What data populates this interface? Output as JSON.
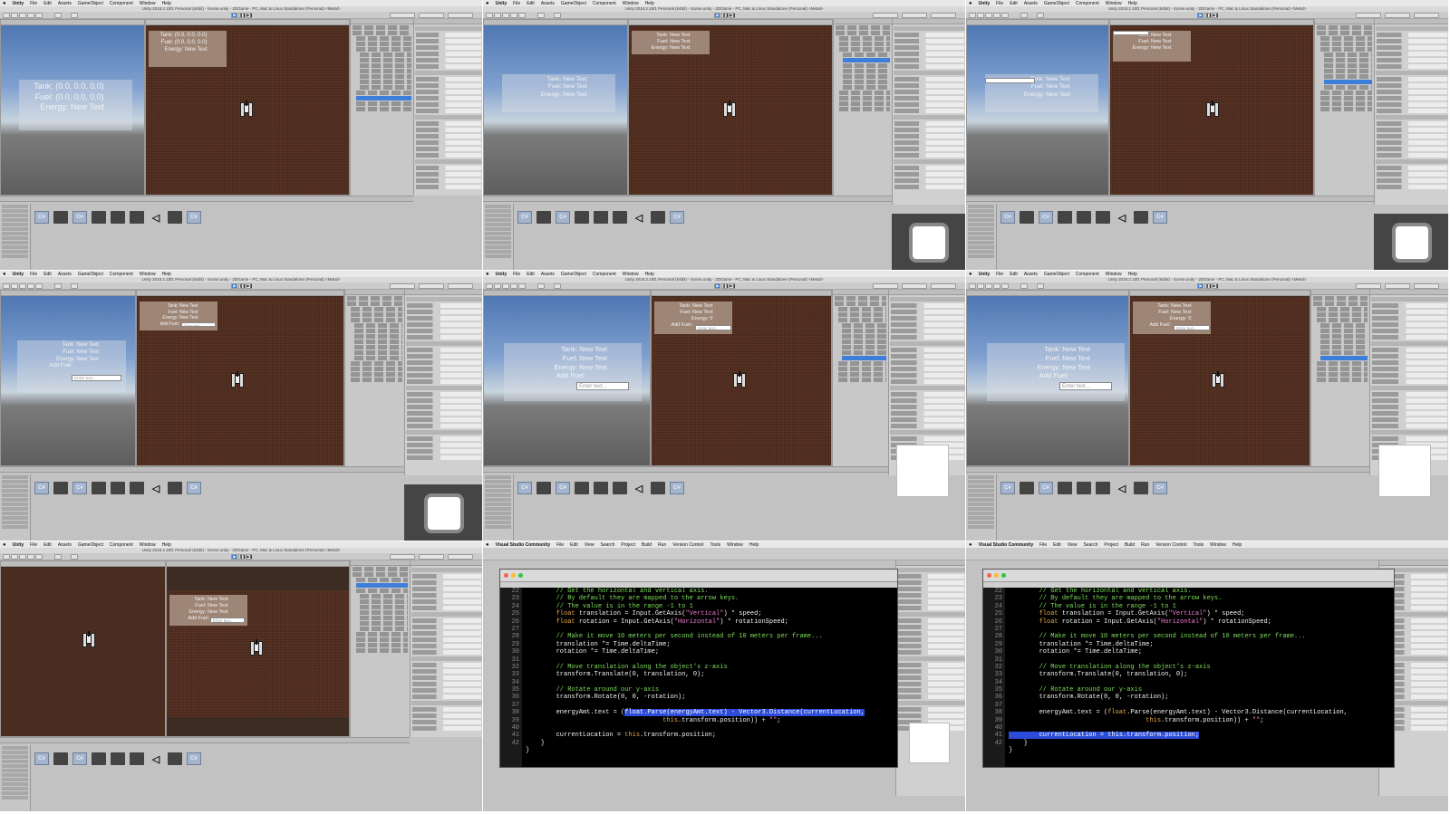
{
  "menubar": {
    "unity": [
      "Unity",
      "File",
      "Edit",
      "Assets",
      "GameObject",
      "Component",
      "Window",
      "Help"
    ],
    "vs": [
      "Visual Studio Community",
      "File",
      "Edit",
      "View",
      "Search",
      "Project",
      "Build",
      "Run",
      "Version Control",
      "Tools",
      "Window",
      "Help"
    ]
  },
  "window_title": "Unity 2018.2.15f1 Personal (64bit) - Scene.unity - 2DGame - PC, Mac & Linux Standalone (Personal) <Metal>",
  "game_ui": {
    "tank_vec": "Tank: (0.0, 0.0, 0.0)",
    "fuel_vec": "Fuel: (0.0, 0.0, 0.0)",
    "tank_text": "Tank: New Text",
    "fuel_text": "Fuel: New Text",
    "energy_text": "Energy: New Text",
    "energy_zero": "Energy: 0",
    "add_fuel": "Add Fuel:",
    "enter_text": "Enter text..."
  },
  "assets": [
    {
      "icon": "csharp-script-icon",
      "kind": "cs",
      "glyph": "C#"
    },
    {
      "icon": "material-icon",
      "kind": "mat",
      "glyph": ""
    },
    {
      "icon": "csharp-script-icon",
      "kind": "cs",
      "glyph": "C#"
    },
    {
      "icon": "material-icon",
      "kind": "mat",
      "glyph": ""
    },
    {
      "icon": "material-icon",
      "kind": "mat",
      "glyph": ""
    },
    {
      "icon": "material-icon",
      "kind": "mat",
      "glyph": ""
    },
    {
      "icon": "unity-scene-icon",
      "kind": "uty",
      "glyph": "◁"
    },
    {
      "icon": "material-icon",
      "kind": "mat",
      "glyph": ""
    },
    {
      "icon": "csharp-script-icon",
      "kind": "cs",
      "glyph": "C#"
    }
  ],
  "code": {
    "line_numbers": [
      "22",
      "23",
      "24",
      "25",
      "26",
      "27",
      "28",
      "29",
      "30",
      "31",
      "32",
      "33",
      "34",
      "35",
      "36",
      "37",
      "38",
      "39",
      "40",
      "41",
      "42"
    ],
    "lines": [
      {
        "parts": [
          {
            "t": "        "
          },
          {
            "t": "// Get the horizontal and vertical axis.",
            "c": "com"
          }
        ]
      },
      {
        "parts": [
          {
            "t": "        "
          },
          {
            "t": "// By default they are mapped to the arrow keys.",
            "c": "com"
          }
        ]
      },
      {
        "parts": [
          {
            "t": "        "
          },
          {
            "t": "// The value is in the range -1 to 1",
            "c": "com"
          }
        ]
      },
      {
        "parts": [
          {
            "t": "        "
          },
          {
            "t": "float",
            "c": "key"
          },
          {
            "t": " translation = Input.GetAxis("
          },
          {
            "t": "\"Vertical\"",
            "c": "str"
          },
          {
            "t": ") * speed;"
          }
        ]
      },
      {
        "parts": [
          {
            "t": "        "
          },
          {
            "t": "float",
            "c": "key"
          },
          {
            "t": " rotation = Input.GetAxis("
          },
          {
            "t": "\"Horizontal\"",
            "c": "str"
          },
          {
            "t": ") * rotationSpeed;"
          }
        ]
      },
      {
        "parts": [
          {
            "t": ""
          }
        ]
      },
      {
        "parts": [
          {
            "t": "        "
          },
          {
            "t": "// Make it move 10 meters per second instead of 10 meters per frame...",
            "c": "com"
          }
        ]
      },
      {
        "parts": [
          {
            "t": "        translation *= Time.deltaTime;"
          }
        ]
      },
      {
        "parts": [
          {
            "t": "        rotation *= Time.deltaTime;"
          }
        ]
      },
      {
        "parts": [
          {
            "t": ""
          }
        ]
      },
      {
        "parts": [
          {
            "t": "        "
          },
          {
            "t": "// Move translation along the object's z-axis",
            "c": "com"
          }
        ]
      },
      {
        "parts": [
          {
            "t": "        transform.Translate(0, translation, 0);"
          }
        ]
      },
      {
        "parts": [
          {
            "t": ""
          }
        ]
      },
      {
        "parts": [
          {
            "t": "        "
          },
          {
            "t": "// Rotate around our y-axis",
            "c": "com"
          }
        ]
      },
      {
        "parts": [
          {
            "t": "        transform.Rotate(0, 0, -rotation);"
          }
        ]
      },
      {
        "parts": [
          {
            "t": ""
          }
        ]
      },
      {
        "parts": [
          {
            "t": "        energyAmt.text = ("
          },
          {
            "t": "float",
            "c": "key"
          },
          {
            "t": ".Parse(energyAmt.text) - Vector3.Distance(currentLocation,"
          }
        ]
      },
      {
        "parts": [
          {
            "t": "                                    "
          },
          {
            "t": "this",
            "c": "key"
          },
          {
            "t": ".transform.position)) + "
          },
          {
            "t": "\"\"",
            "c": "str"
          },
          {
            "t": ";"
          }
        ]
      },
      {
        "parts": [
          {
            "t": ""
          }
        ]
      },
      {
        "parts": [
          {
            "t": "        currentLocation = "
          },
          {
            "t": "this",
            "c": "key"
          },
          {
            "t": ".transform.position;"
          }
        ]
      },
      {
        "parts": [
          {
            "t": "    }"
          }
        ]
      },
      {
        "parts": [
          {
            "t": "}"
          }
        ]
      }
    ]
  },
  "colors": {
    "selection": "#3d7fd8",
    "code_bg": "#000000",
    "comment": "#7ddf5b",
    "keyword": "#e6a84a",
    "string": "#f27ad0",
    "highlight": "#2b4bd8"
  }
}
